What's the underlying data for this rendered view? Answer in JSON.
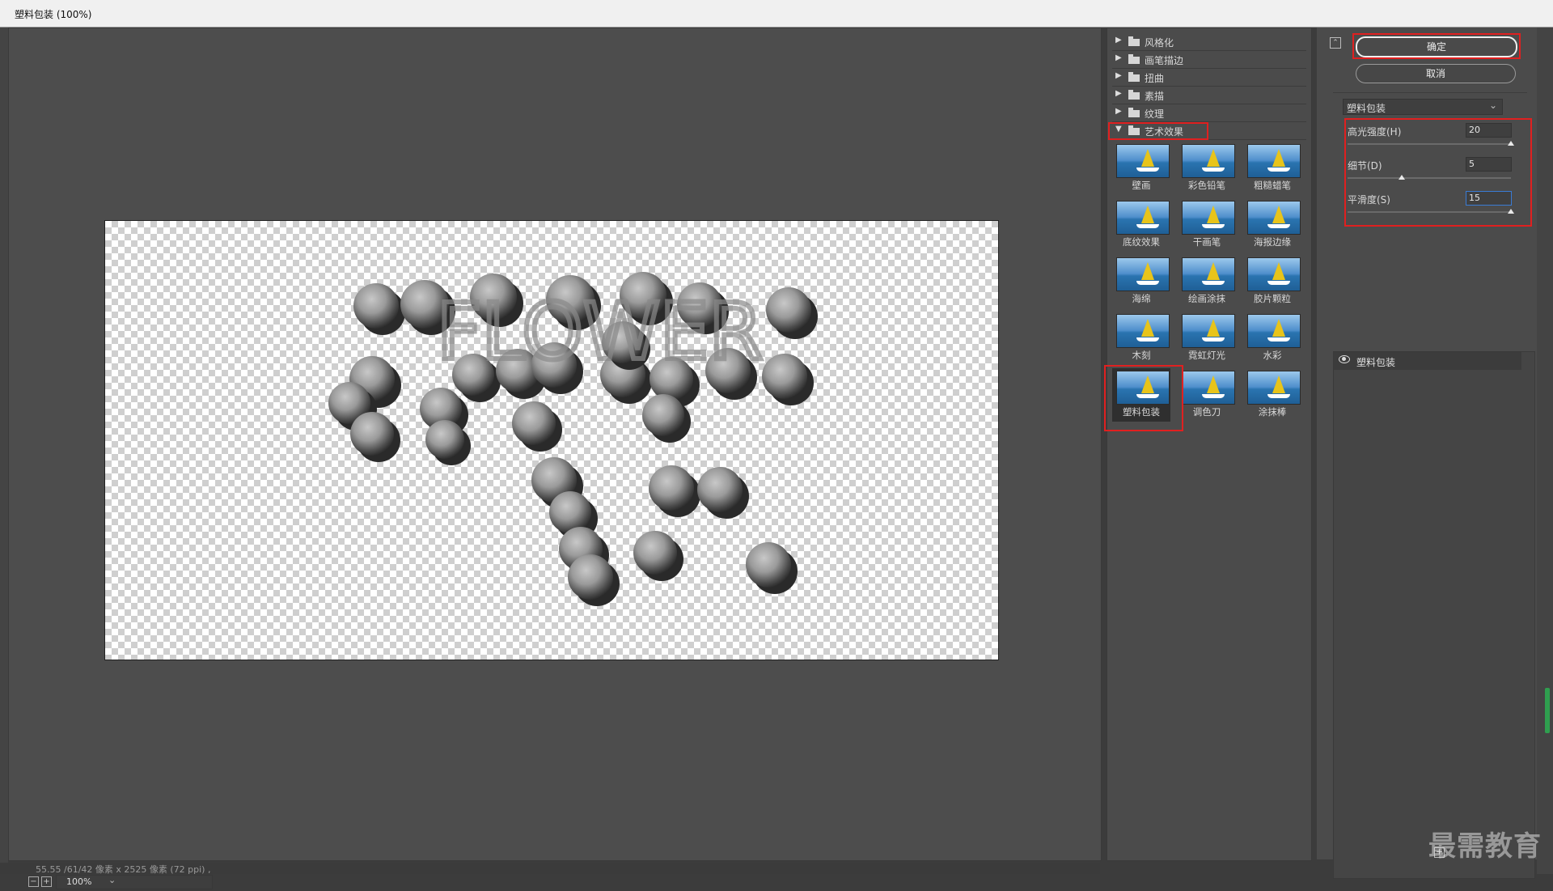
{
  "window": {
    "title": "塑料包装 (100%)"
  },
  "preview": {
    "zoom_value": "100%",
    "status_text": "55.55 /61/42 像素 x 2525 像素 (72 ppi) ,",
    "canvas_text": "FLOWER"
  },
  "gallery": {
    "categories": [
      {
        "label": "风格化",
        "expanded": false
      },
      {
        "label": "画笔描边",
        "expanded": false
      },
      {
        "label": "扭曲",
        "expanded": false
      },
      {
        "label": "素描",
        "expanded": false
      },
      {
        "label": "纹理",
        "expanded": false
      },
      {
        "label": "艺术效果",
        "expanded": true
      }
    ],
    "thumbs": [
      "壁画",
      "彩色铅笔",
      "粗糙蜡笔",
      "底纹效果",
      "干画笔",
      "海报边缘",
      "海绵",
      "绘画涂抹",
      "胶片颗粒",
      "木刻",
      "霓虹灯光",
      "水彩",
      "塑料包装",
      "调色刀",
      "涂抹棒"
    ],
    "selected": "塑料包装"
  },
  "controls": {
    "ok_label": "确定",
    "cancel_label": "取消",
    "filter_select": "塑料包装",
    "params": [
      {
        "label": "高光强度(H)",
        "value": "20",
        "level": 1.0
      },
      {
        "label": "细节(D)",
        "value": "5",
        "level": 0.33
      },
      {
        "label": "平滑度(S)",
        "value": "15",
        "level": 1.0
      }
    ]
  },
  "layers": {
    "items": [
      {
        "label": "塑料包装"
      }
    ]
  },
  "watermark": "最需教育",
  "colors": {
    "highlight": "#e02020",
    "panel": "#4b4b4b",
    "focus": "#3a7bd5"
  }
}
